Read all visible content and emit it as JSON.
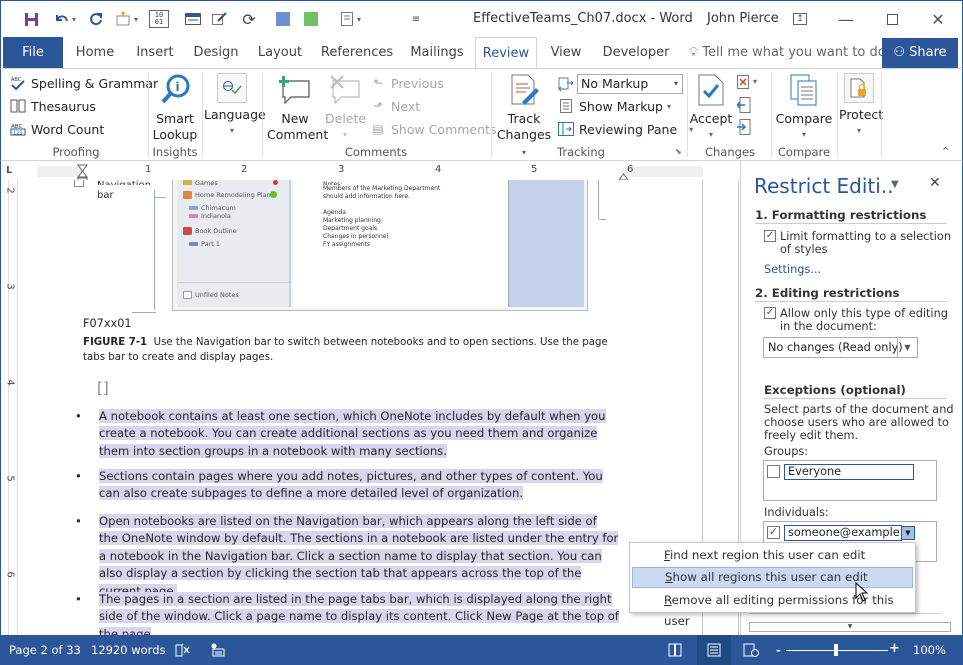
{
  "title_bar": {
    "document_title": "EffectiveTeams_Ch07.docx - Word",
    "user_name": "John Pierce",
    "qat_icons": [
      "save-icon",
      "undo-icon",
      "redo-icon",
      "format-painter-icon",
      "binary-field-icon",
      "form-icon",
      "edit-icon",
      "refresh-icon",
      "blue-color-icon",
      "green-color-icon",
      "layout-icon",
      "customize-qat-icon"
    ],
    "window_controls": [
      "ribbon-display-options",
      "minimize",
      "maximize",
      "close"
    ]
  },
  "tabs": {
    "items": [
      "File",
      "Home",
      "Insert",
      "Design",
      "Layout",
      "References",
      "Mailings",
      "Review",
      "View",
      "Developer"
    ],
    "active": "Review",
    "tell_me_placeholder": "Tell me what you want to do",
    "share_label": "Share"
  },
  "ribbon": {
    "proofing": {
      "label": "Proofing",
      "spelling": "Spelling & Grammar",
      "thesaurus": "Thesaurus",
      "word_count": "Word Count"
    },
    "insights": {
      "label": "Insights",
      "smart_lookup_1": "Smart",
      "smart_lookup_2": "Lookup"
    },
    "language": {
      "label": "Language"
    },
    "comments": {
      "label": "Comments",
      "new_1": "New",
      "new_2": "Comment",
      "delete": "Delete",
      "previous": "Previous",
      "next": "Next",
      "show_comments": "Show Comments"
    },
    "tracking": {
      "label": "Tracking",
      "track_1": "Track",
      "track_2": "Changes",
      "markup_value": "No Markup",
      "show_markup": "Show Markup",
      "reviewing_pane": "Reviewing Pane"
    },
    "changes": {
      "label": "Changes",
      "accept": "Accept"
    },
    "compare": {
      "label": "Compare",
      "compare": "Compare"
    },
    "protect": {
      "protect": "Protect"
    }
  },
  "rulers": {
    "horizontal": [
      "1",
      "2",
      "3",
      "4",
      "5",
      "6"
    ],
    "vertical": [
      "2",
      "3",
      "4",
      "5",
      "6"
    ]
  },
  "document": {
    "figure": {
      "callout_label_1": "Navigation",
      "callout_label_2": "bar",
      "nav_items": [
        "Games",
        "Home Remodeling Plans",
        "Chimacum",
        "Indianola",
        "Book Outline",
        "Part 1",
        "Unfiled Notes"
      ],
      "note_lines": [
        "Notes:",
        "Members of the Marketing Department",
        "should add information here.",
        "",
        "Agenda",
        "Marketing planning",
        "Department goals",
        "Changes in personnel",
        "FY assignments"
      ]
    },
    "figure_id": "F07xx01",
    "caption_label": "FIGURE 7-1",
    "caption_text": "Use the Navigation bar to switch between notebooks and to open sections. Use the page tabs bar to create and display pages.",
    "placeholder_bracket": "[]",
    "bullets": [
      "A notebook contains at least one section, which OneNote includes by default when you create a notebook. You can create additional sections as you need them and organize them into section groups in a notebook with many sections.",
      "Sections contain pages where you add notes, pictures, and other types of content. You can also create subpages to define a more detailed level of organization.",
      "Open notebooks are listed on the Navigation bar, which appears along the left side of the OneNote window by default. The sections in a notebook are listed under the entry for a notebook in the Navigation bar. Click a section name to display that section. You can also display a section by clicking the section tab that appears across the top of the current page.",
      "The pages in a section are listed in the page tabs bar, which is displayed along the right side of the window. Click a page name to display its content. Click New Page at the top of the page"
    ],
    "highlight_color": "#d8d6ec"
  },
  "restrict_pane": {
    "title": "Restrict Editi..",
    "section1_heading": "1. Formatting restrictions",
    "limit_formatting_label_1": "Limit formatting to a selection",
    "limit_formatting_label_2": "of styles",
    "limit_formatting_checked": true,
    "settings_link": "Settings...",
    "section2_heading": "2. Editing restrictions",
    "allow_only_label_1": "Allow only this type of editing",
    "allow_only_label_2": "in the document:",
    "allow_only_checked": true,
    "editing_type_value": "No changes (Read only)",
    "exceptions_heading": "Exceptions (optional)",
    "exceptions_desc_1": "Select parts of the document and",
    "exceptions_desc_2": "choose users who are allowed to",
    "exceptions_desc_3": "freely edit them.",
    "groups_label": "Groups:",
    "group_entry": "Everyone",
    "group_checked": false,
    "individuals_label": "Individuals:",
    "individual_entry": "someone@example.co",
    "individual_checked": true
  },
  "context_menu": {
    "items": [
      {
        "accel": "F",
        "rest": "ind next region this user can edit"
      },
      {
        "accel": "S",
        "rest": "how all regions this user can edit"
      },
      {
        "accel": "R",
        "rest": "emove all editing permissions for this user"
      }
    ],
    "hovered_index": 1
  },
  "status_bar": {
    "page": "Page 2 of 33",
    "words": "12920 words",
    "zoom": "100%",
    "zoom_percent": 100,
    "active_view": "print-layout"
  },
  "colors": {
    "accent": "#2b579a",
    "menu_hover": "#cbdaf1"
  }
}
